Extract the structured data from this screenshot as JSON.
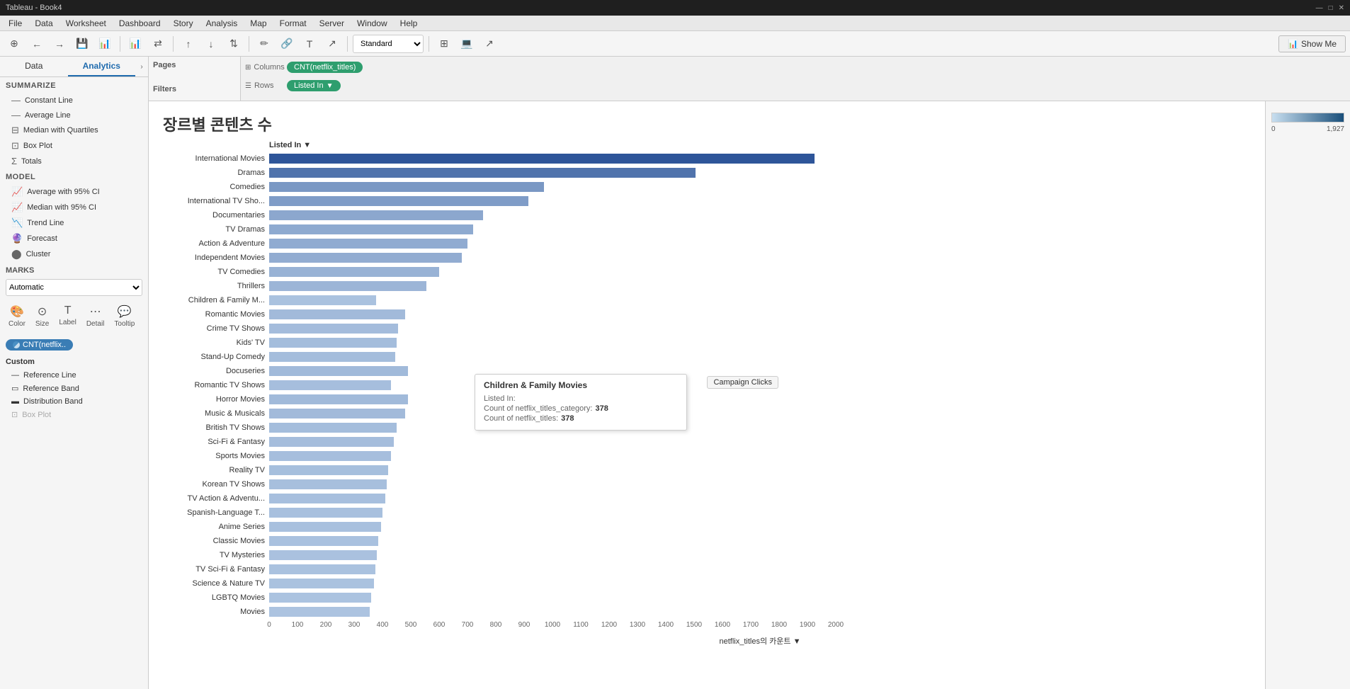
{
  "app": {
    "title": "Tableau - Book4",
    "window_controls": [
      "—",
      "□",
      "✕"
    ]
  },
  "menu": {
    "items": [
      "File",
      "Data",
      "Worksheet",
      "Dashboard",
      "Story",
      "Analysis",
      "Map",
      "Format",
      "Server",
      "Window",
      "Help"
    ]
  },
  "toolbar": {
    "show_me_label": "Show Me",
    "dropdown_value": "Standard"
  },
  "tabs": {
    "data_label": "Data",
    "analytics_label": "Analytics"
  },
  "analytics_panel": {
    "summarize_header": "Summarize",
    "items_summarize": [
      "Constant Line",
      "Average Line",
      "Median with Quartiles",
      "Box Plot",
      "Totals"
    ],
    "model_header": "Model",
    "items_model": [
      "Average with 95% CI",
      "Median with 95% CI",
      "Trend Line",
      "Forecast",
      "Cluster"
    ],
    "custom_header": "Custom",
    "items_custom": [
      "Reference Line",
      "Reference Band",
      "Distribution Band",
      "Box Plot"
    ]
  },
  "marks": {
    "header": "Marks",
    "dropdown": "Automatic",
    "icons": [
      "Color",
      "Size",
      "Label",
      "Detail",
      "Tooltip"
    ],
    "cnt_pill": "CNT(netflix.."
  },
  "pages_label": "Pages",
  "filters_label": "Filters",
  "shelf": {
    "columns_label": "Columns",
    "columns_pill": "CNT(netflix_titles)",
    "rows_label": "Rows",
    "rows_pill": "Listed In",
    "rows_filter_icon": "▼"
  },
  "chart": {
    "title": "장르별 콘텐츠 수",
    "x_axis_label": "netflix_titles의 카운트 ▼",
    "listed_in_label": "Listed In ▼",
    "x_ticks": [
      "0",
      "100",
      "200",
      "300",
      "400",
      "500",
      "600",
      "700",
      "800",
      "900",
      "1000",
      "1100",
      "1200",
      "1300",
      "1400",
      "1500",
      "1600",
      "1700",
      "1800",
      "1900",
      "2000"
    ],
    "bars": [
      {
        "label": "International Movies",
        "value": 1925,
        "max": 2000,
        "pct": 96.25
      },
      {
        "label": "Dramas",
        "value": 1505,
        "max": 2000,
        "pct": 75.25
      },
      {
        "label": "Comedies",
        "value": 970,
        "max": 2000,
        "pct": 48.5
      },
      {
        "label": "International TV Sho...",
        "value": 915,
        "max": 2000,
        "pct": 45.75
      },
      {
        "label": "Documentaries",
        "value": 755,
        "max": 2000,
        "pct": 37.75
      },
      {
        "label": "TV Dramas",
        "value": 720,
        "max": 2000,
        "pct": 36.0
      },
      {
        "label": "Action & Adventure",
        "value": 700,
        "max": 2000,
        "pct": 35.0
      },
      {
        "label": "Independent Movies",
        "value": 680,
        "max": 2000,
        "pct": 34.0
      },
      {
        "label": "TV Comedies",
        "value": 600,
        "max": 2000,
        "pct": 30.0
      },
      {
        "label": "Thrillers",
        "value": 555,
        "max": 2000,
        "pct": 27.75
      },
      {
        "label": "Children & Family M...",
        "value": 378,
        "max": 2000,
        "pct": 18.9,
        "highlighted": true
      },
      {
        "label": "Romantic Movies",
        "value": 480,
        "max": 2000,
        "pct": 24.0
      },
      {
        "label": "Crime TV Shows",
        "value": 455,
        "max": 2000,
        "pct": 22.75
      },
      {
        "label": "Kids' TV",
        "value": 450,
        "max": 2000,
        "pct": 22.5
      },
      {
        "label": "Stand-Up Comedy",
        "value": 445,
        "max": 2000,
        "pct": 22.25
      },
      {
        "label": "Docuseries",
        "value": 490,
        "max": 2000,
        "pct": 24.5
      },
      {
        "label": "Romantic TV Shows",
        "value": 430,
        "max": 2000,
        "pct": 21.5
      },
      {
        "label": "Horror Movies",
        "value": 490,
        "max": 2000,
        "pct": 24.5
      },
      {
        "label": "Music & Musicals",
        "value": 480,
        "max": 2000,
        "pct": 24.0
      },
      {
        "label": "British TV Shows",
        "value": 450,
        "max": 2000,
        "pct": 22.5
      },
      {
        "label": "Sci-Fi & Fantasy",
        "value": 440,
        "max": 2000,
        "pct": 22.0
      },
      {
        "label": "Sports Movies",
        "value": 430,
        "max": 2000,
        "pct": 21.5
      },
      {
        "label": "Reality TV",
        "value": 420,
        "max": 2000,
        "pct": 21.0
      },
      {
        "label": "Korean TV Shows",
        "value": 415,
        "max": 2000,
        "pct": 20.75
      },
      {
        "label": "TV Action & Adventu...",
        "value": 410,
        "max": 2000,
        "pct": 20.5
      },
      {
        "label": "Spanish-Language T...",
        "value": 400,
        "max": 2000,
        "pct": 20.0
      },
      {
        "label": "Anime Series",
        "value": 395,
        "max": 2000,
        "pct": 19.75
      },
      {
        "label": "Classic Movies",
        "value": 385,
        "max": 2000,
        "pct": 19.25
      },
      {
        "label": "TV Mysteries",
        "value": 380,
        "max": 2000,
        "pct": 19.0
      },
      {
        "label": "TV Sci-Fi & Fantasy",
        "value": 375,
        "max": 2000,
        "pct": 18.75
      },
      {
        "label": "Science & Nature TV",
        "value": 370,
        "max": 2000,
        "pct": 18.5
      },
      {
        "label": "LGBTQ Movies",
        "value": 360,
        "max": 2000,
        "pct": 18.0
      },
      {
        "label": "Movies",
        "value": 355,
        "max": 2000,
        "pct": 17.75
      }
    ]
  },
  "tooltip": {
    "title": "Children & Family Movies",
    "listed_in_key": "Listed In:",
    "listed_in_val": "",
    "count_category_key": "Count of netflix_titles_category:",
    "count_category_val": "378",
    "count_key": "Count of netflix_titles:",
    "count_val": "378",
    "campaign_clicks_label": "Campaign Clicks"
  },
  "color_legend": {
    "min": "0",
    "max": "1,927"
  }
}
